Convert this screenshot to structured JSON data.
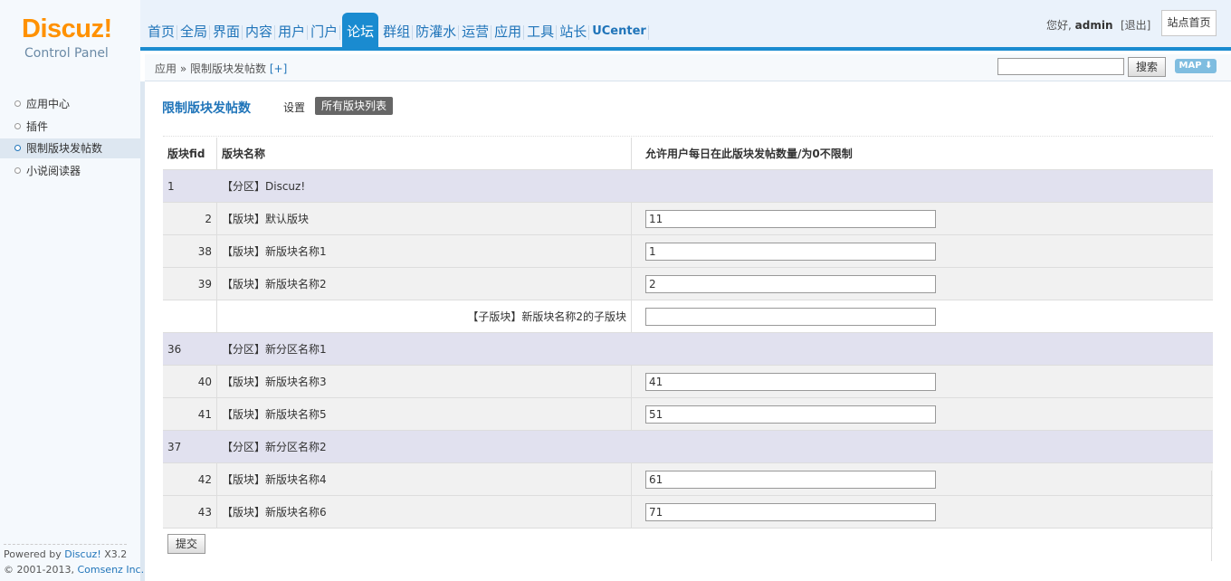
{
  "header": {
    "logo_main": "Discuz!",
    "logo_sub": "Control Panel",
    "nav": [
      "首页",
      "全局",
      "界面",
      "内容",
      "用户",
      "门户",
      "论坛",
      "群组",
      "防灌水",
      "运营",
      "应用",
      "工具",
      "站长",
      "UCenter"
    ],
    "active_nav": "论坛",
    "greeting": "您好,",
    "username": "admin",
    "logout": "[退出]",
    "site_home": "站点首页"
  },
  "subbar": {
    "breadcrumb_root": "应用",
    "breadcrumb_sep": "»",
    "breadcrumb_current": "限制版块发帖数",
    "breadcrumb_plus": "[+]",
    "search_value": "",
    "search_button": "搜索",
    "map_label": "MAP ⬇"
  },
  "sidebar": {
    "items": [
      {
        "label": "应用中心"
      },
      {
        "label": "插件"
      },
      {
        "label": "限制版块发帖数"
      },
      {
        "label": "小说阅读器"
      }
    ],
    "footer_line1_prefix": "Powered by ",
    "footer_line1_link": "Discuz!",
    "footer_line1_suffix": " X3.2",
    "footer_line2_prefix": "© 2001-2013, ",
    "footer_line2_link": "Comsenz Inc."
  },
  "main": {
    "title": "限制版块发帖数",
    "tab_settings": "设置",
    "tab_all": "所有版块列表",
    "headers": {
      "fid": "版块fid",
      "name": "版块名称",
      "limit": "允许用户每日在此版块发帖数量/为0不限制"
    },
    "rows": [
      {
        "type": "group",
        "fid": "1",
        "name": "【分区】Discuz!"
      },
      {
        "type": "forum",
        "fid": "2",
        "name": "【版块】默认版块",
        "value": "11"
      },
      {
        "type": "forum",
        "fid": "38",
        "name": "【版块】新版块名称1",
        "value": "1"
      },
      {
        "type": "forum",
        "fid": "39",
        "name": "【版块】新版块名称2",
        "value": "2"
      },
      {
        "type": "sub",
        "fid": "",
        "name": "【子版块】新版块名称2的子版块",
        "value": ""
      },
      {
        "type": "group",
        "fid": "36",
        "name": "【分区】新分区名称1"
      },
      {
        "type": "forum",
        "fid": "40",
        "name": "【版块】新版块名称3",
        "value": "41"
      },
      {
        "type": "forum",
        "fid": "41",
        "name": "【版块】新版块名称5",
        "value": "51"
      },
      {
        "type": "group",
        "fid": "37",
        "name": "【分区】新分区名称2"
      },
      {
        "type": "forum",
        "fid": "42",
        "name": "【版块】新版块名称4",
        "value": "61"
      },
      {
        "type": "forum",
        "fid": "43",
        "name": "【版块】新版块名称6",
        "value": "71"
      }
    ],
    "submit": "提交"
  }
}
